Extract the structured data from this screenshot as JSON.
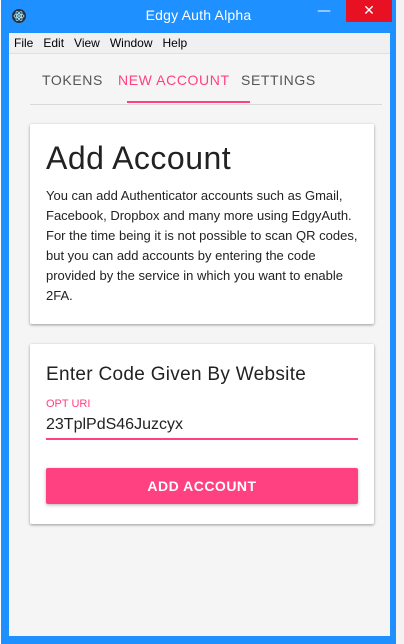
{
  "window": {
    "title": "Edgy Auth Alpha",
    "minimize_icon": "minimize-icon",
    "close_icon": "close-icon",
    "minimize_glyph": "—",
    "close_glyph": "✕"
  },
  "menu": {
    "items": [
      "File",
      "Edit",
      "View",
      "Window",
      "Help"
    ]
  },
  "tabs": {
    "items": [
      {
        "label": "TOKENS"
      },
      {
        "label": "NEW ACCOUNT"
      },
      {
        "label": "SETTINGS"
      }
    ],
    "active": "NEW ACCOUNT"
  },
  "intro": {
    "title": "Add Account",
    "text": "You can add Authenticator accounts such as Gmail, Facebook, Dropbox and many more using EdgyAuth. For the time being it is not possible to scan QR codes, but you can add accounts by entering the code provided by the service in which you want to enable 2FA."
  },
  "form": {
    "title": "Enter Code Given By Website",
    "field_label": "OPT URI",
    "field_value": "23TplPdS46Juzcyx",
    "button_label": "ADD ACCOUNT"
  },
  "colors": {
    "accent": "#ff4081",
    "titlebar": "#1e90ff",
    "close": "#e81123"
  }
}
